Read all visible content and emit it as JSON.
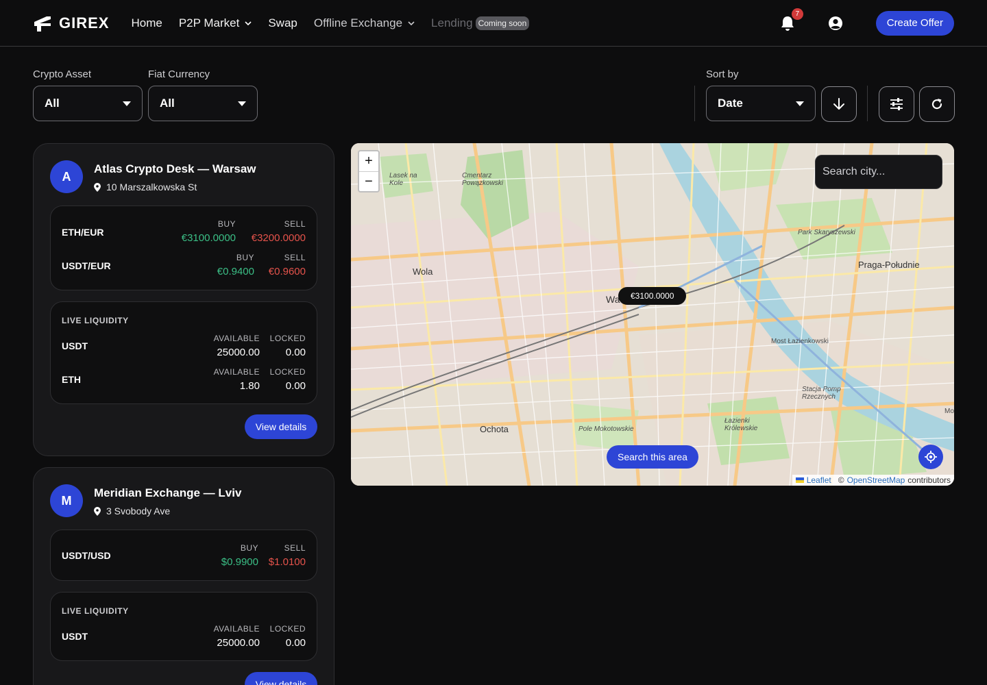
{
  "nav": {
    "brand": "GIREX",
    "links": [
      {
        "label": "Home"
      },
      {
        "label": "P2P Market"
      },
      {
        "label": "Swap"
      },
      {
        "label": "Offline Exchange"
      },
      {
        "label": "Lending"
      }
    ],
    "coming_soon": "Coming soon",
    "notification_count": "7",
    "create_offer": "Create Offer"
  },
  "filters": {
    "crypto_label": "Crypto Asset",
    "crypto_value": "All",
    "fiat_label": "Fiat Currency",
    "fiat_value": "All",
    "sort_label": "Sort by",
    "sort_value": "Date"
  },
  "cards": [
    {
      "initial": "A",
      "title": "Atlas Crypto Desk — Warsaw",
      "address": "10 Marszalkowska St",
      "buy_head": "BUY",
      "sell_head": "SELL",
      "rates": [
        {
          "pair": "ETH/EUR",
          "buy": "€3100.0000",
          "sell": "€3200.0000"
        },
        {
          "pair": "USDT/EUR",
          "buy": "€0.9400",
          "sell": "€0.9600"
        }
      ],
      "liquidity_title": "LIVE LIQUIDITY",
      "available_head": "AVAILABLE",
      "locked_head": "LOCKED",
      "liquidity": [
        {
          "asset": "USDT",
          "available": "25000.00",
          "locked": "0.00"
        },
        {
          "asset": "ETH",
          "available": "1.80",
          "locked": "0.00"
        }
      ],
      "view_details": "View details"
    },
    {
      "initial": "M",
      "title": "Meridian Exchange — Lviv",
      "address": "3 Svobody Ave",
      "buy_head": "BUY",
      "sell_head": "SELL",
      "rates": [
        {
          "pair": "USDT/USD",
          "buy": "$0.9900",
          "sell": "$1.0100"
        }
      ],
      "liquidity_title": "LIVE LIQUIDITY",
      "available_head": "AVAILABLE",
      "locked_head": "LOCKED",
      "liquidity": [
        {
          "asset": "USDT",
          "available": "25000.00",
          "locked": "0.00"
        }
      ],
      "view_details": "View details"
    }
  ],
  "map": {
    "search_placeholder": "Search city...",
    "price_marker": "€3100.0000",
    "search_area": "Search this area",
    "zoom_in": "+",
    "zoom_out": "−",
    "attribution_leaflet": "Leaflet",
    "attribution_sep": "©",
    "attribution_osm": "OpenStreetMap",
    "attribution_contrib": "contributors",
    "labels": {
      "wola": "Wola",
      "praga": "Praga-Południe",
      "ochota": "Ochota",
      "park": "Park Skaryszewski",
      "most": "Most Łazienkowski",
      "lazienki": "Łazienki Królewskie",
      "pole": "Pole Mokotowskie",
      "cmentarz": "Cmentarz Powązkowski",
      "lasek": "Lasek na Kole",
      "stacja": "Stacja Pomp Rzecznych",
      "wa": "Wa",
      "mo": "Mo"
    }
  },
  "colors": {
    "accent": "#2d45d6",
    "buy": "#3bbf86",
    "sell": "#e5534b",
    "badge": "#d23a3a"
  }
}
